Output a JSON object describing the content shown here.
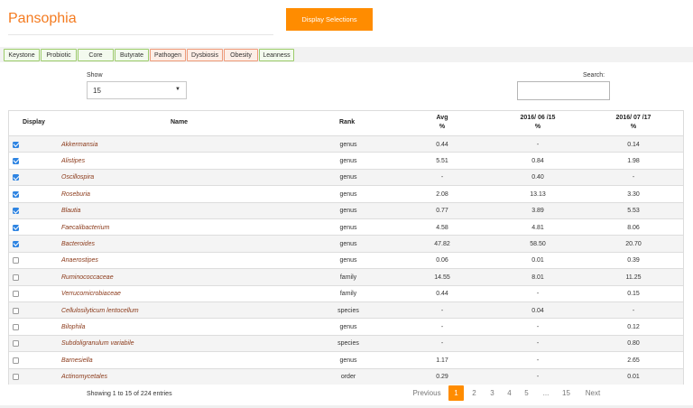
{
  "header": {
    "brand": "Pansophia",
    "display_button": "Display Selections"
  },
  "tags": [
    {
      "label": "Keystone",
      "style": "green"
    },
    {
      "label": "Probiotic",
      "style": "green"
    },
    {
      "label": "Core",
      "style": "green"
    },
    {
      "label": "Butyrate",
      "style": "green"
    },
    {
      "label": "Pathogen",
      "style": "orange"
    },
    {
      "label": "Dysbiosis",
      "style": "orange"
    },
    {
      "label": "Obesity",
      "style": "orange"
    },
    {
      "label": "Leanness",
      "style": "green"
    }
  ],
  "controls": {
    "show_label": "Show",
    "show_value": "15",
    "search_label": "Search:",
    "search_value": ""
  },
  "table": {
    "headers": {
      "display": "Display",
      "name": "Name",
      "rank": "Rank",
      "avg": "Avg",
      "avg_unit": "%",
      "d1": "2016/ 06 /15",
      "d1_unit": "%",
      "d2": "2016/ 07 /17",
      "d2_unit": "%"
    },
    "rows": [
      {
        "checked": true,
        "name": "Akkermansia",
        "rank": "genus",
        "avg": "0.44",
        "d1": "-",
        "d2": "0.14"
      },
      {
        "checked": true,
        "name": "Alistipes",
        "rank": "genus",
        "avg": "5.51",
        "d1": "0.84",
        "d2": "1.98"
      },
      {
        "checked": true,
        "name": "Oscillospira",
        "rank": "genus",
        "avg": "-",
        "d1": "0.40",
        "d2": "-"
      },
      {
        "checked": true,
        "name": "Roseburia",
        "rank": "genus",
        "avg": "2.08",
        "d1": "13.13",
        "d2": "3.30"
      },
      {
        "checked": true,
        "name": "Blautia",
        "rank": "genus",
        "avg": "0.77",
        "d1": "3.89",
        "d2": "5.53"
      },
      {
        "checked": true,
        "name": "Faecalibacterium",
        "rank": "genus",
        "avg": "4.58",
        "d1": "4.81",
        "d2": "8.06"
      },
      {
        "checked": true,
        "name": "Bacteroides",
        "rank": "genus",
        "avg": "47.82",
        "d1": "58.50",
        "d2": "20.70"
      },
      {
        "checked": false,
        "name": "Anaerostipes",
        "rank": "genus",
        "avg": "0.06",
        "d1": "0.01",
        "d2": "0.39"
      },
      {
        "checked": false,
        "name": "Ruminococcaceae",
        "rank": "family",
        "avg": "14.55",
        "d1": "8.01",
        "d2": "11.25"
      },
      {
        "checked": false,
        "name": "Verrucomicrobiaceae",
        "rank": "family",
        "avg": "0.44",
        "d1": "-",
        "d2": "0.15"
      },
      {
        "checked": false,
        "name": "Cellulosilyticum lentocellum",
        "rank": "species",
        "avg": "-",
        "d1": "0.04",
        "d2": "-"
      },
      {
        "checked": false,
        "name": "Bilophila",
        "rank": "genus",
        "avg": "-",
        "d1": "-",
        "d2": "0.12"
      },
      {
        "checked": false,
        "name": "Subdoligranulum variabile",
        "rank": "species",
        "avg": "-",
        "d1": "-",
        "d2": "0.80"
      },
      {
        "checked": false,
        "name": "Barnesiella",
        "rank": "genus",
        "avg": "1.17",
        "d1": "-",
        "d2": "2.65"
      },
      {
        "checked": false,
        "name": "Actinomycetales",
        "rank": "order",
        "avg": "0.29",
        "d1": "-",
        "d2": "0.01"
      }
    ]
  },
  "footer": {
    "info": "Showing 1 to 15 of 224 entries",
    "previous": "Previous",
    "pages": [
      "1",
      "2",
      "3",
      "4",
      "5",
      "...",
      "15"
    ],
    "current_page": "1",
    "next": "Next"
  },
  "colors": {
    "accent": "#ff8c00",
    "brand": "#f47b20",
    "checkbox": "#2e84e2",
    "taxon_name": "#8b3a1a"
  }
}
